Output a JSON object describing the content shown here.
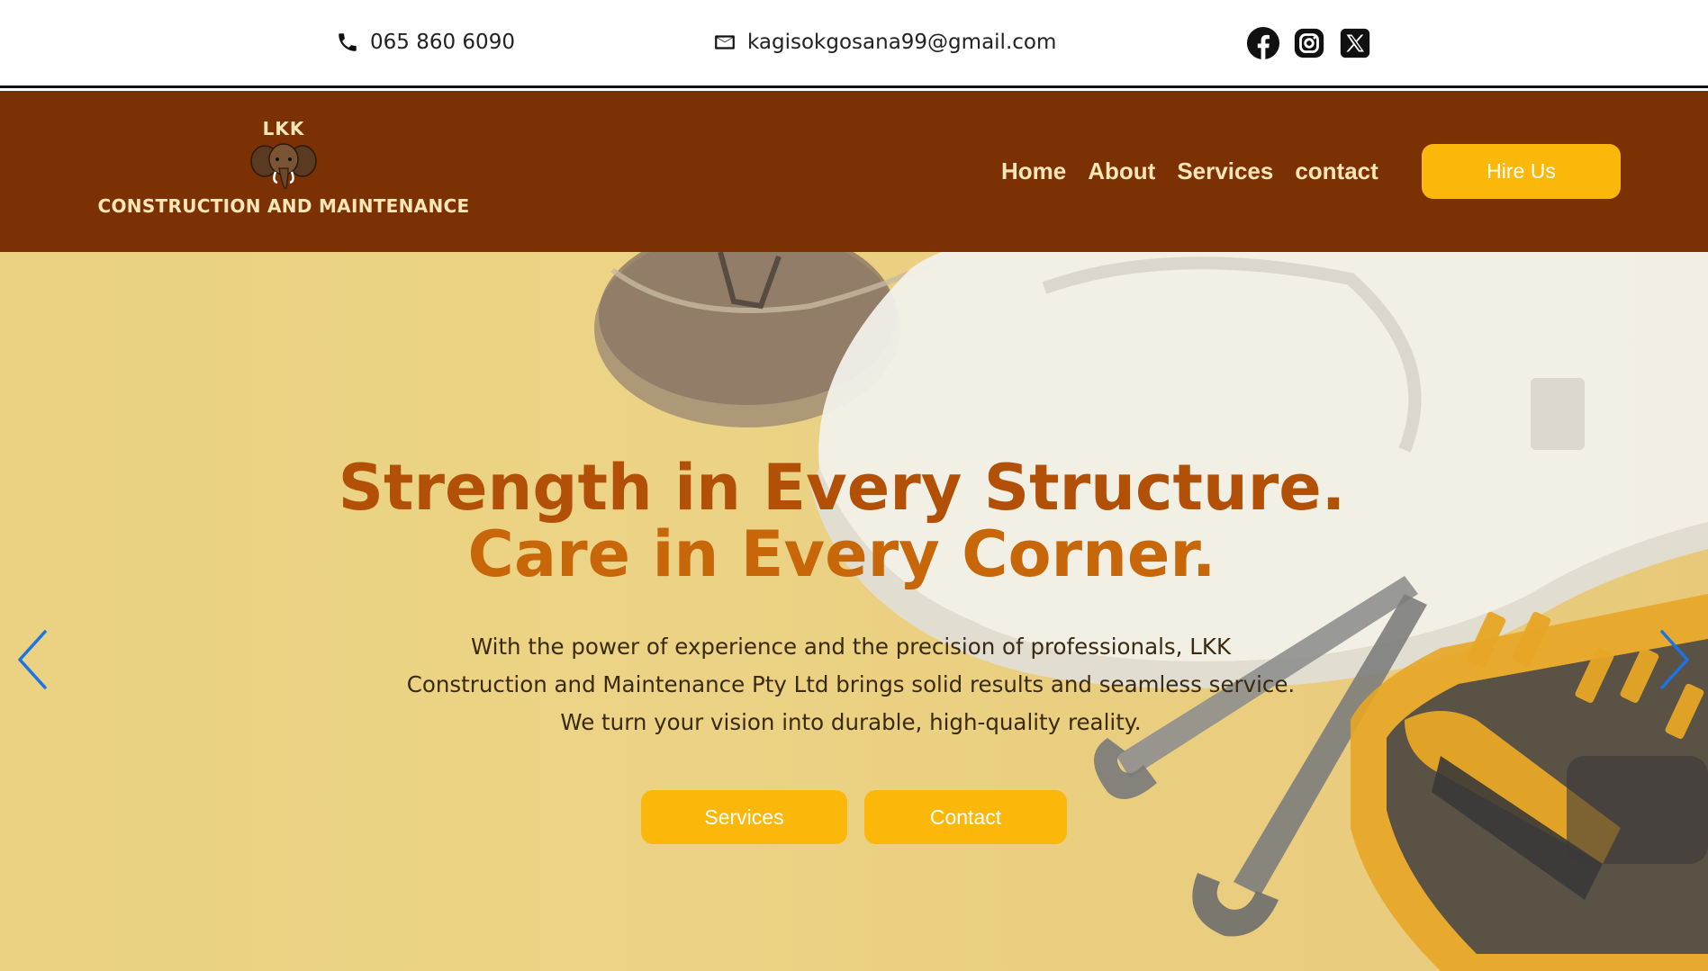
{
  "topbar": {
    "phone": "065 860 6090",
    "email": "kagisokgosana99@gmail.com",
    "socials": [
      {
        "name": "facebook-icon"
      },
      {
        "name": "instagram-icon"
      },
      {
        "name": "x-icon"
      }
    ]
  },
  "header": {
    "logo_top": "LKK",
    "logo_bottom": "CONSTRUCTION AND MAINTENANCE",
    "nav": [
      "Home",
      "About",
      "Services",
      "contact"
    ],
    "hire_label": "Hire Us"
  },
  "hero": {
    "title_line1": "Strength in Every Structure.",
    "title_line2": "Care in Every Corner.",
    "text_line1": "With the power of experience and the precision of professionals, LKK",
    "text_line2": "Construction and Maintenance Pty Ltd brings solid results and seamless service.",
    "text_line3": "We turn your vision into durable, high-quality reality.",
    "btn_services": "Services",
    "btn_contact": "Contact"
  },
  "colors": {
    "header_bg": "#7b3104",
    "accent": "#fbb80b",
    "nav_text": "#fbe6b8",
    "title_dark": "#b25008",
    "title_light": "#c8660a",
    "arrow": "#1a73e8"
  }
}
